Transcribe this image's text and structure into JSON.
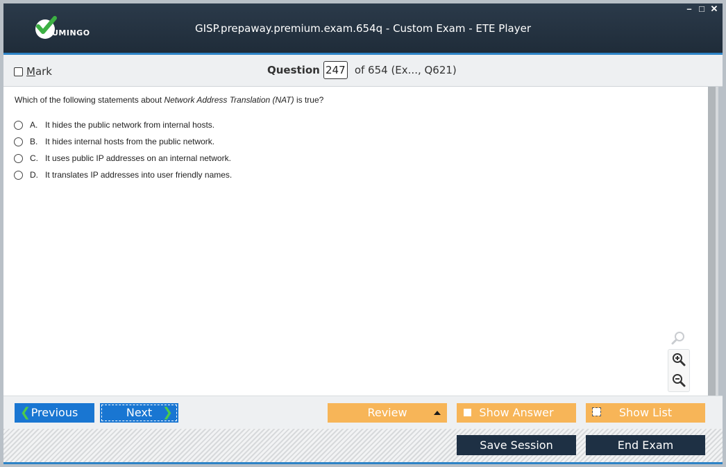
{
  "app": {
    "logo_text": "UMINGO",
    "window_title": "GISP.prepaway.premium.exam.654q - Custom Exam - ETE Player",
    "window_controls": {
      "minimize": "–",
      "maximize": "□",
      "close": "✕"
    }
  },
  "header": {
    "mark_label": "Mark",
    "question_label": "Question",
    "question_number": "247",
    "question_suffix": "of 654 (Ex..., Q621)"
  },
  "question": {
    "text_before": "Which of the following statements about ",
    "text_em": "Network Address Translation (NAT)",
    "text_after": " is true?",
    "answers": [
      {
        "letter": "A.",
        "text": "It hides the public network from internal hosts."
      },
      {
        "letter": "B.",
        "text": "It hides internal hosts from the public network."
      },
      {
        "letter": "C.",
        "text": "It uses public IP addresses on an internal network."
      },
      {
        "letter": "D.",
        "text": "It translates IP addresses into user friendly names."
      }
    ]
  },
  "toolbar": {
    "previous_label": "Previous",
    "next_label": "Next",
    "review_label": "Review",
    "show_answer_label": "Show Answer",
    "show_list_label": "Show List",
    "save_session_label": "Save Session",
    "end_exam_label": "End Exam"
  },
  "icons": {
    "search": "magnifier-icon",
    "zoom_in": "zoom-in-icon",
    "zoom_out": "zoom-out-icon"
  },
  "colors": {
    "titlebar": "#1f2c39",
    "accent_blue": "#1976d2",
    "orange": "#f7b558",
    "dark_button": "#1e3044",
    "check_green": "#4ccb4c"
  }
}
